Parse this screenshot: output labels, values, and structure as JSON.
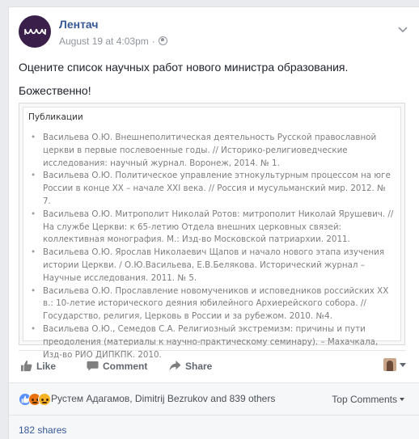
{
  "post": {
    "page_name": "Лентач",
    "timestamp": "August 19 at 4:03pm",
    "separator": "·",
    "text_line1": "Оцените список научных работ нового министра образования.",
    "text_line2": "Божественно!"
  },
  "attachment": {
    "title": "Публикации",
    "items": [
      "Васильева О.Ю. Внешнеполитическая деятельность Русской православной церкви в первые послевоенные годы. // Историко-религиоведческие исследования: научный журнал. Воронеж, 2014. № 1.",
      "Васильева О.Ю. Политическое управление этнокультурным процессом на юге России в конце XX – начале XXI века. // Россия и мусульманский мир. 2012. № 7.",
      "Васильева О.Ю. Митрополит Николай Ротов: митрополит Николай Ярушевич. // На службе Церкви: к 65-летию Отдела внешних церковных связей: коллективная монография. М.: Изд-во Московской патриархии. 2011.",
      "Васильева О.Ю. Ярослав Николаевич Щапов и начало нового этапа изучения истории Церкви. / О.Ю.Васильева, Е.В.Белякова. Исторический журнал – Научные исследования. 2011. № 5.",
      "Васильева О.Ю. Прославление новомучеников и исповедников российских XX в.: 10-летие исторического деяния юбилейного Архиерейского собора. // Государство, религия, Церковь в России и за рубежом. 2010. №4.",
      "Васильева О.Ю., Семедов С.А. Религиозный экстремизм: причины и пути преодоления (материалы к научно-практическому семинару). – Махачкала, Изд-во РИО ДИПКПК. 2010."
    ]
  },
  "actions": {
    "like_label": "Like",
    "comment_label": "Comment",
    "share_label": "Share"
  },
  "reactions": {
    "summary": "Рустем Адагамов, Dimitrij Bezrukov and 839 others",
    "sort_label": "Top Comments",
    "icons": [
      "like-icon",
      "angry-icon",
      "sad-icon"
    ]
  },
  "shares": {
    "label": "182 shares"
  },
  "colors": {
    "link_blue": "#365899",
    "avatar_bg": "#3a1f4a",
    "like_blue": "#5890ff",
    "angry_orange": "#e9710f",
    "sad_yellow": "#f7b125"
  }
}
